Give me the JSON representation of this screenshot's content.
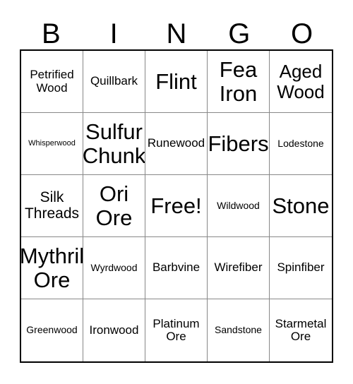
{
  "header": {
    "letters": [
      "B",
      "I",
      "N",
      "G",
      "O"
    ]
  },
  "grid": {
    "columns": 5,
    "rows": 5,
    "border_color": "#000000",
    "gridline_color": "#888888",
    "background_color": "#ffffff",
    "text_color": "#000000",
    "cells": [
      {
        "label": "Petrified Wood",
        "size": "m",
        "column": "B",
        "row": 1
      },
      {
        "label": "Quillbark",
        "size": "m",
        "column": "I",
        "row": 1
      },
      {
        "label": "Flint",
        "size": "xxl",
        "column": "N",
        "row": 1
      },
      {
        "label": "Fea Iron",
        "size": "xxl",
        "column": "G",
        "row": 1
      },
      {
        "label": "Aged Wood",
        "size": "xl",
        "column": "O",
        "row": 1
      },
      {
        "label": "Whisperwood",
        "size": "xs",
        "column": "B",
        "row": 2
      },
      {
        "label": "Sulfur Chunk",
        "size": "xxl",
        "column": "I",
        "row": 2
      },
      {
        "label": "Runewood",
        "size": "m",
        "column": "N",
        "row": 2
      },
      {
        "label": "Fibers",
        "size": "xxl",
        "column": "G",
        "row": 2
      },
      {
        "label": "Lodestone",
        "size": "s",
        "column": "O",
        "row": 2
      },
      {
        "label": "Silk Threads",
        "size": "l",
        "column": "B",
        "row": 3
      },
      {
        "label": "Ori Ore",
        "size": "xxl",
        "column": "I",
        "row": 3
      },
      {
        "label": "Free!",
        "size": "xxl",
        "column": "N",
        "row": 3
      },
      {
        "label": "Wildwood",
        "size": "s",
        "column": "G",
        "row": 3
      },
      {
        "label": "Stone",
        "size": "xxl",
        "column": "O",
        "row": 3
      },
      {
        "label": "Mythril Ore",
        "size": "xxl",
        "column": "B",
        "row": 4
      },
      {
        "label": "Wyrdwood",
        "size": "s",
        "column": "I",
        "row": 4
      },
      {
        "label": "Barbvine",
        "size": "m",
        "column": "N",
        "row": 4
      },
      {
        "label": "Wirefiber",
        "size": "m",
        "column": "G",
        "row": 4
      },
      {
        "label": "Spinfiber",
        "size": "m",
        "column": "O",
        "row": 4
      },
      {
        "label": "Greenwood",
        "size": "s",
        "column": "B",
        "row": 5
      },
      {
        "label": "Ironwood",
        "size": "m",
        "column": "I",
        "row": 5
      },
      {
        "label": "Platinum Ore",
        "size": "m",
        "column": "N",
        "row": 5
      },
      {
        "label": "Sandstone",
        "size": "s",
        "column": "G",
        "row": 5
      },
      {
        "label": "Starmetal Ore",
        "size": "m",
        "column": "O",
        "row": 5
      }
    ]
  }
}
